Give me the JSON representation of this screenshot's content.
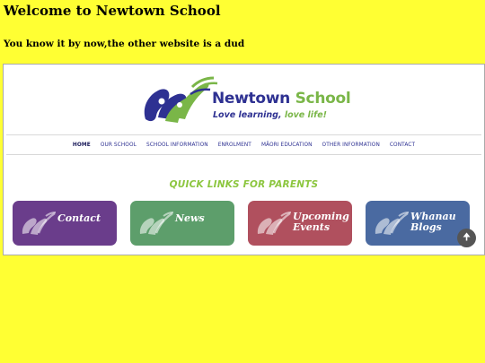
{
  "page": {
    "title": "Welcome to Newtown School",
    "subtitle": "You know it by now,the other website is a dud"
  },
  "site": {
    "logo": {
      "name_part1": "Newtown ",
      "name_part2": "School",
      "tagline_part1": "Love learning, ",
      "tagline_part2": "love life!"
    },
    "nav": [
      {
        "label": "HOME",
        "active": true
      },
      {
        "label": "OUR SCHOOL"
      },
      {
        "label": "SCHOOL INFORMATION"
      },
      {
        "label": "ENROLMENT"
      },
      {
        "label": "MĀORI EDUCATION"
      },
      {
        "label": "OTHER INFORMATION"
      },
      {
        "label": "CONTACT"
      }
    ],
    "quick_links_title": "QUICK LINKS FOR PARENTS",
    "quick_links": [
      {
        "label_line1": "Contact",
        "label_line2": "",
        "color": "#6a3d8b"
      },
      {
        "label_line1": "News",
        "label_line2": "",
        "color": "#5d9e6b"
      },
      {
        "label_line1": "Upcoming",
        "label_line2": "Events",
        "color": "#b0505e"
      },
      {
        "label_line1": "Whanau",
        "label_line2": "Blogs",
        "color": "#4a6aa1"
      }
    ],
    "scroll_top_icon": "arrow-up-icon"
  },
  "colors": {
    "page_background": "#ffff33",
    "brand_navy": "#2e3192",
    "brand_green": "#7ab648"
  }
}
